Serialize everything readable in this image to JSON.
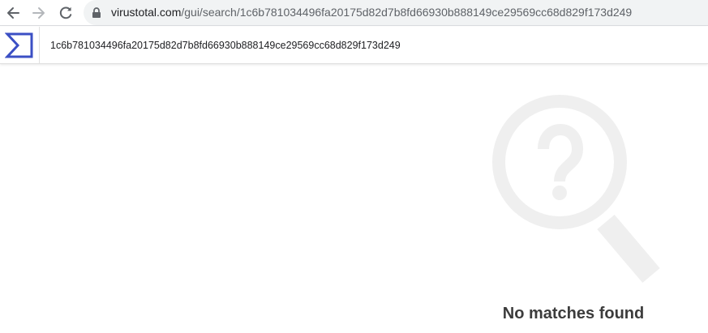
{
  "browser": {
    "url_host": "virustotal.com",
    "url_path": "/gui/search/1c6b781034496fa20175d82d7b8fd66930b888149ce29569cc68d829f173d249"
  },
  "virustotal": {
    "search_value": "1c6b781034496fa20175d82d7b8fd66930b888149ce29569cc68d829f173d249"
  },
  "results": {
    "message": "No matches found"
  },
  "icons": [
    "back-arrow-icon",
    "forward-arrow-icon",
    "reload-icon",
    "lock-icon",
    "virustotal-logo-icon",
    "magnifier-question-icon"
  ],
  "colors": {
    "brand": "#3b4fc4",
    "illustration": "#efefef",
    "message_text": "#3c3c3c"
  }
}
